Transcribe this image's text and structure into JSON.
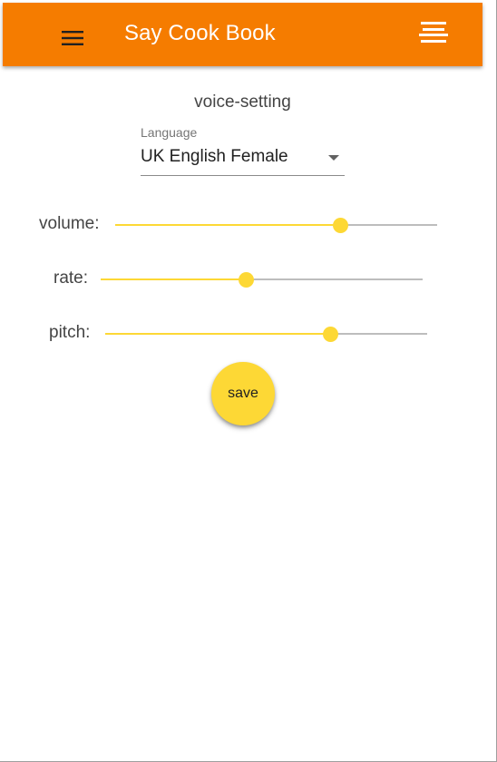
{
  "app": {
    "title": "Say Cook Book",
    "menu_icon": "hamburger-menu-icon",
    "list_icon": "list-icon",
    "bar_color": "#f57c00"
  },
  "voice_setting": {
    "title": "voice-setting",
    "language": {
      "label": "Language",
      "value": "UK English Female"
    },
    "sliders": [
      {
        "label": "volume:",
        "value": 0.7
      },
      {
        "label": "rate:",
        "value": 0.45
      },
      {
        "label": "pitch:",
        "value": 0.7
      }
    ],
    "save_label": "save",
    "accent_color": "#fdd835"
  }
}
